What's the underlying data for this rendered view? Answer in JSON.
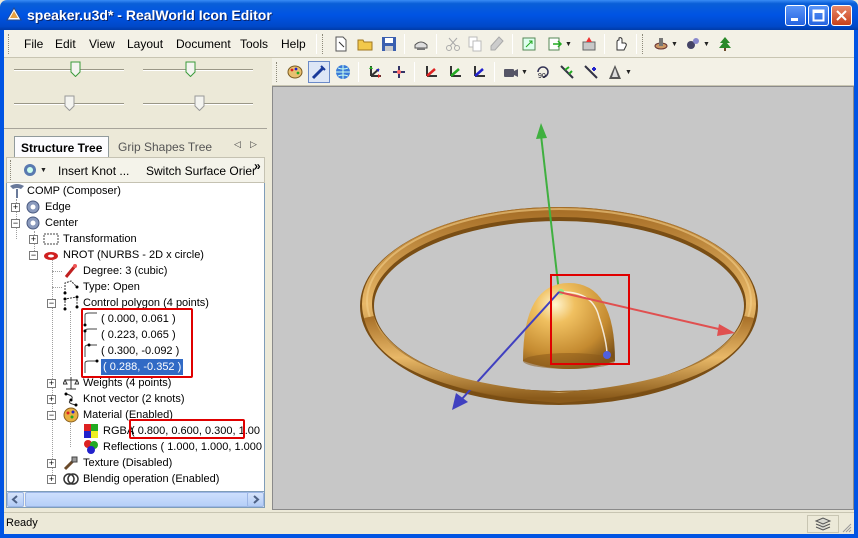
{
  "window": {
    "title": "speaker.u3d* - RealWorld Icon Editor"
  },
  "menu": [
    "File",
    "Edit",
    "View",
    "Layout",
    "Document",
    "Tools",
    "Help"
  ],
  "panel_tabs": {
    "active": "Structure Tree",
    "inactive": "Grip Shapes Tree"
  },
  "tree_toolbar": {
    "insert_knot": "Insert Knot ...",
    "switch_surface": "Switch Surface Orier",
    "overflow": "»"
  },
  "tree": {
    "comp": "COMP (Composer)",
    "edge": "Edge",
    "center": "Center",
    "transformation": "Transformation",
    "nrot": "NROT (NURBS - 2D x circle)",
    "degree": "Degree: 3 (cubic)",
    "type": "Type: Open",
    "control_polygon": "Control polygon (4 points)",
    "points": [
      "( 0.000, 0.061 )",
      "( 0.223, 0.065 )",
      "( 0.300, -0.092 )",
      "( 0.288, -0.352 )"
    ],
    "weights": "Weights (4 points)",
    "knot_vector": "Knot vector (2 knots)",
    "material": "Material (Enabled)",
    "rgba_label": "RGBA",
    "rgba_value": "( 0.800, 0.600, 0.300, 1.00",
    "reflections": "Reflections ( 1.000, 1.000, 1.000",
    "texture": "Texture (Disabled)",
    "blending": "Blendig operation (Enabled)"
  },
  "status": {
    "text": "Ready"
  },
  "colors": {
    "title_blue": "#0054e3",
    "viewport_bg": "#c7c7c7",
    "ring": "#c8923f",
    "x_axis": "#e05050",
    "y_axis": "#40b040",
    "z_axis": "#4040c0",
    "highlight": "#e00000"
  }
}
